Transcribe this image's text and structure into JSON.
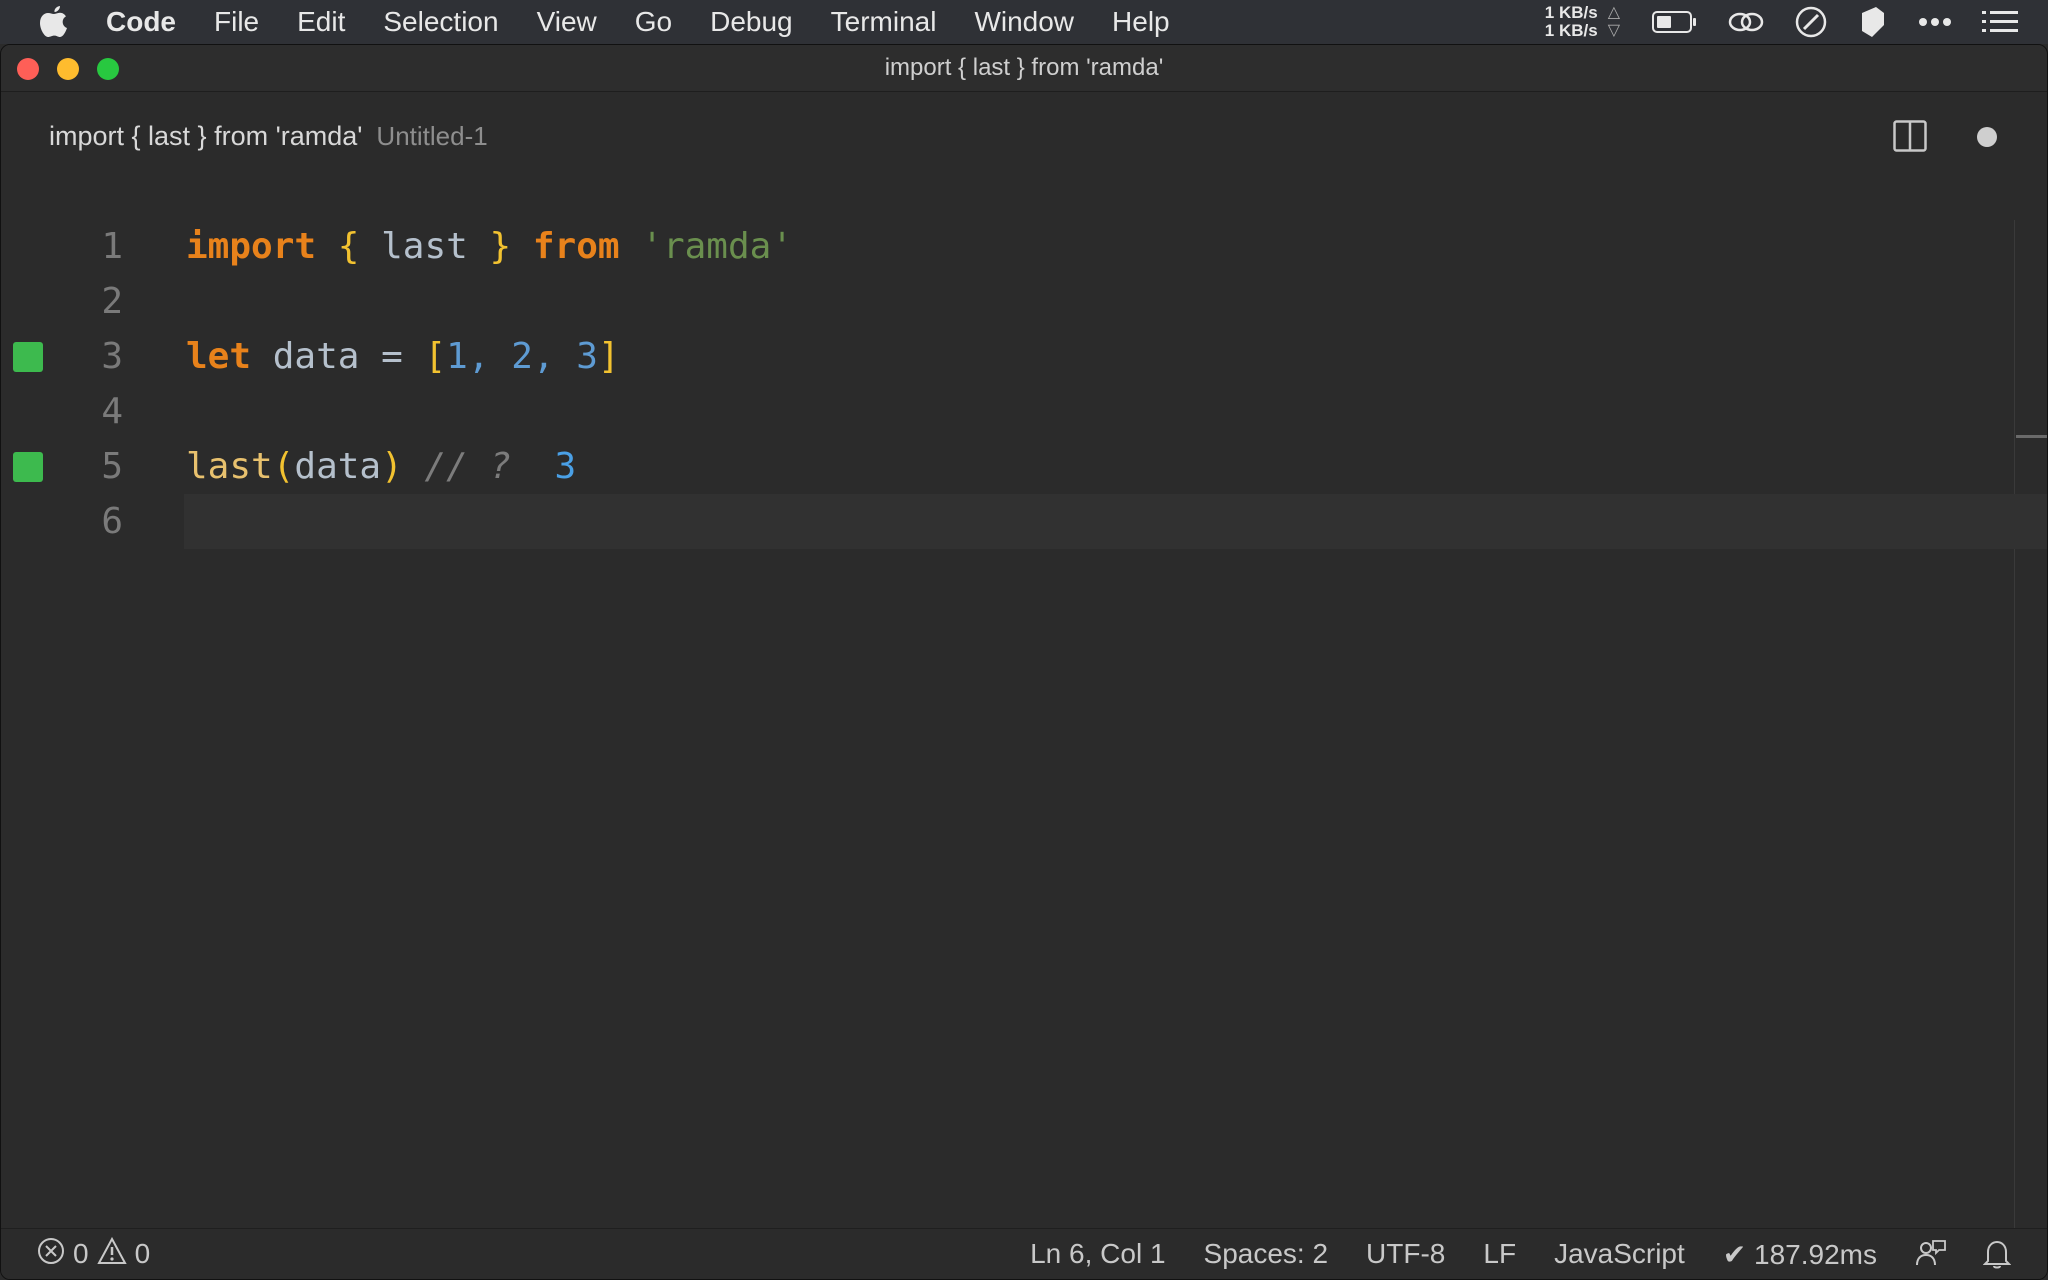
{
  "menubar": {
    "app": "Code",
    "items": [
      "File",
      "Edit",
      "Selection",
      "View",
      "Go",
      "Debug",
      "Terminal",
      "Window",
      "Help"
    ],
    "net_up": "1 KB/s",
    "net_down": "1 KB/s"
  },
  "window": {
    "title": "import { last } from 'ramda'"
  },
  "tab": {
    "title": "import { last } from 'ramda'",
    "description": "Untitled-1"
  },
  "editor": {
    "line_numbers": [
      "1",
      "2",
      "3",
      "4",
      "5",
      "6"
    ],
    "line1": {
      "kw_import": "import",
      "brace_open": "{",
      "ident": "last",
      "brace_close": "}",
      "kw_from": "from",
      "string": "'ramda'"
    },
    "line3": {
      "kw_let": "let",
      "ident": "data",
      "eq": "=",
      "bracket_open": "[",
      "n1": "1",
      "c1": ",",
      "n2": "2",
      "c2": ",",
      "n3": "3",
      "bracket_close": "]"
    },
    "line5": {
      "fn": "last",
      "paren_open": "(",
      "arg": "data",
      "paren_close": ")",
      "comment": "// ?",
      "result": "3"
    }
  },
  "statusbar": {
    "errors": "0",
    "warnings": "0",
    "position": "Ln 6, Col 1",
    "spaces": "Spaces: 2",
    "encoding": "UTF-8",
    "eol": "LF",
    "language": "JavaScript",
    "timing": "✔ 187.92ms"
  },
  "colors": {
    "keyword": "#e8821b",
    "bracket": "#f2c230",
    "string": "#6a8f4e",
    "number": "#5e9bd3",
    "coverage": "#3dba4e"
  }
}
